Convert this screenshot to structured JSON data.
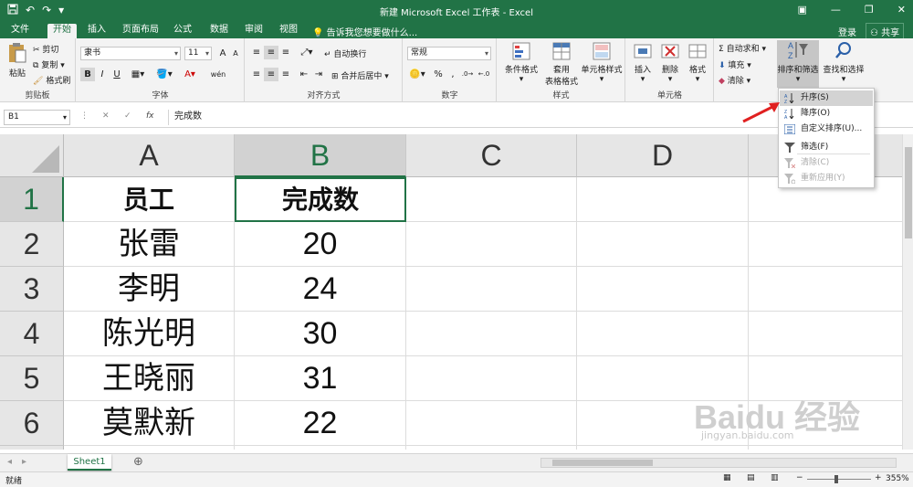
{
  "titlebar": {
    "title": "新建 Microsoft Excel 工作表 - Excel",
    "save_icon": "save-icon",
    "undo": "↶",
    "redo": "↷"
  },
  "tabs": {
    "file": "文件",
    "home": "开始",
    "insert": "插入",
    "layout": "页面布局",
    "formulas": "公式",
    "data": "数据",
    "review": "审阅",
    "view": "视图",
    "tell": "告诉我您想要做什么...",
    "login": "登录",
    "share": "共享"
  },
  "ribbon": {
    "clipboard": {
      "paste": "粘贴",
      "cut": "剪切",
      "copy": "复制",
      "painter": "格式刷",
      "label": "剪贴板"
    },
    "font": {
      "name": "隶书",
      "size": "11",
      "bold": "B",
      "italic": "I",
      "underline": "U",
      "label": "字体",
      "grow": "A",
      "shrink": "A",
      "wen": "wén"
    },
    "align": {
      "wrap": "自动换行",
      "merge": "合并后居中",
      "label": "对齐方式"
    },
    "number": {
      "format": "常规",
      "label": "数字",
      "percent": "%",
      "comma": ","
    },
    "styles": {
      "cond": "条件格式",
      "table": "套用",
      "table2": "表格格式",
      "cell": "单元格样式",
      "label": "样式"
    },
    "cells": {
      "insert": "插入",
      "delete": "删除",
      "format": "格式",
      "label": "单元格"
    },
    "editing": {
      "autosum": "自动求和",
      "fill": "填充",
      "clear": "清除",
      "sort": "排序和筛选",
      "find": "查找和选择"
    }
  },
  "formula": {
    "namebox": "B1",
    "fx": "fx",
    "content": "完成数"
  },
  "columns": [
    "A",
    "B",
    "C",
    "D"
  ],
  "rows": [
    "1",
    "2",
    "3",
    "4",
    "5",
    "6"
  ],
  "table": [
    [
      "员工",
      "完成数"
    ],
    [
      "张雷",
      "20"
    ],
    [
      "李明",
      "24"
    ],
    [
      "陈光明",
      "30"
    ],
    [
      "王晓丽",
      "31"
    ],
    [
      "莫默新",
      "22"
    ]
  ],
  "menu": {
    "asc": "升序(S)",
    "desc": "降序(O)",
    "custom": "自定义排序(U)...",
    "filter": "筛选(F)",
    "clear": "清除(C)",
    "reapply": "重新应用(Y)"
  },
  "sheets": {
    "sheet1": "Sheet1",
    "add": "⊕"
  },
  "status": {
    "ready": "就绪",
    "zoom": "355%"
  },
  "watermark": {
    "brand": "Baidu 经验",
    "url": "jingyan.baidu.com"
  },
  "colors": {
    "excel_green": "#217346",
    "accent_red": "#e02020"
  }
}
